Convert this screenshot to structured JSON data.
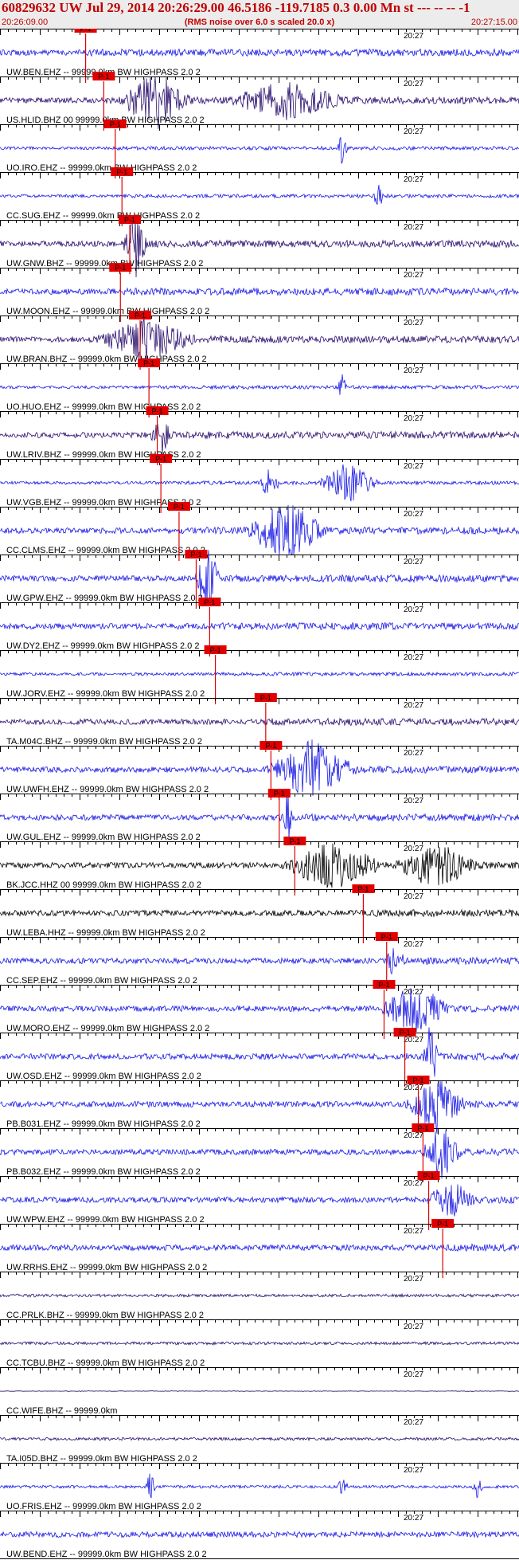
{
  "header": {
    "title": "60829632 UW Jul 29, 2014 20:26:29.00   46.5186 -119.7185  0.3 0.00 Mn st --- -- --  -1",
    "start_time": "20:26:09.00",
    "subtitle": "(RMS noise over 6.0 s scaled 20.0 x)",
    "end_time": "20:27:15.00"
  },
  "time_label": "20:27",
  "pick_label": "P-1",
  "colors": {
    "header_text": "#c00000",
    "pick": "#e00000"
  },
  "traces": [
    {
      "label": "UW.BEN.EHZ -- 99999.0km BW  HIGHPASS  2.0  2",
      "pick": 0.165,
      "color": "#1a1ae6",
      "bursts": []
    },
    {
      "label": "US.HLID.BHZ 00 99999.0km BW  HIGHPASS  2.0  2",
      "pick": 0.2,
      "color": "#2a0f6e",
      "bursts": [
        [
          0.3,
          0.07,
          2.5
        ],
        [
          0.55,
          0.12,
          1.5
        ]
      ]
    },
    {
      "label": "UO.IRO.EHZ -- 99999.0km BW  HIGHPASS  2.0  2",
      "pick": 0.222,
      "color": "#1a1ae6",
      "bursts": [
        [
          0.66,
          0.01,
          3
        ]
      ],
      "quiet": true
    },
    {
      "label": "CC.SUG.EHZ -- 99999.0km BW  HIGHPASS  2.0  2",
      "pick": 0.235,
      "color": "#1a1ae6",
      "bursts": [
        [
          0.73,
          0.01,
          3
        ]
      ],
      "quiet": true
    },
    {
      "label": "UW.GNW.BHZ -- 99999.0km BW  HIGHPASS  2.0  2",
      "pick": 0.25,
      "color": "#2a0f6e",
      "bursts": [
        [
          0.26,
          0.025,
          3
        ]
      ]
    },
    {
      "label": "UW.MOON.EHZ -- 99999.0km BW  HIGHPASS  2.0  2",
      "pick": 0.232,
      "color": "#1a1ae6",
      "bursts": []
    },
    {
      "label": "UW.BRAN.BHZ -- 99999.0km BW  HIGHPASS  2.0  2",
      "pick": 0.27,
      "color": "#2a0f6e",
      "bursts": [
        [
          0.28,
          0.1,
          1.8
        ]
      ]
    },
    {
      "label": "UO.HUO.EHZ -- 99999.0km BW  HIGHPASS  2.0  2",
      "pick": 0.287,
      "color": "#1a1ae6",
      "bursts": [
        [
          0.66,
          0.01,
          3
        ]
      ],
      "quiet": true
    },
    {
      "label": "UW.LRIV.BHZ -- 99999.0km BW  HIGHPASS  2.0  2",
      "pick": 0.303,
      "color": "#2a0f6e",
      "bursts": [
        [
          0.31,
          0.02,
          1.8
        ]
      ]
    },
    {
      "label": "UW.VGB.EHZ -- 99999.0km BW  HIGHPASS  2.0  2",
      "pick": 0.31,
      "color": "#1a1ae6",
      "bursts": [
        [
          0.52,
          0.02,
          3
        ],
        [
          0.67,
          0.06,
          3.5
        ]
      ],
      "quiet": true
    },
    {
      "label": "CC.CLMS.EHZ -- 99999.0km BW  HIGHPASS  2.0  2",
      "pick": 0.345,
      "color": "#1a1ae6",
      "bursts": [
        [
          0.55,
          0.08,
          2.5
        ]
      ]
    },
    {
      "label": "UW.GPW.EHZ -- 99999.0km BW  HIGHPASS  2.0  2",
      "pick": 0.378,
      "color": "#1a1ae6",
      "bursts": [
        [
          0.4,
          0.025,
          3
        ]
      ]
    },
    {
      "label": "UW.DY2.EHZ -- 99999.0km BW  HIGHPASS  2.0  2",
      "pick": 0.404,
      "color": "#1a1ae6",
      "bursts": []
    },
    {
      "label": "UW.JORV.EHZ -- 99999.0km BW  HIGHPASS  2.0  2",
      "pick": 0.415,
      "color": "#1a1ae6",
      "bursts": [],
      "quiet": true
    },
    {
      "label": "TA.M04C.BHZ -- 99999.0km BW  HIGHPASS  2.0  2",
      "pick": 0.512,
      "color": "#2a0f6e",
      "bursts": []
    },
    {
      "label": "UW.UWFH.EHZ -- 99999.0km BW  HIGHPASS  2.0  2",
      "pick": 0.522,
      "color": "#1a1ae6",
      "bursts": [
        [
          0.6,
          0.09,
          2.5
        ]
      ]
    },
    {
      "label": "UW.GUL.EHZ -- 99999.0km BW  HIGHPASS  2.0  2",
      "pick": 0.538,
      "color": "#1a1ae6",
      "bursts": [
        [
          0.555,
          0.008,
          3
        ]
      ]
    },
    {
      "label": "BK.JCC.HHZ 00 99999.0km BW  HIGHPASS  2.0  2",
      "pick": 0.568,
      "color": "#000000",
      "bursts": [
        [
          0.64,
          0.1,
          2
        ],
        [
          0.84,
          0.08,
          2
        ]
      ]
    },
    {
      "label": "UW.LEBA.HHZ -- 99999.0km BW  HIGHPASS  2.0  2",
      "pick": 0.7,
      "color": "#000000",
      "bursts": []
    },
    {
      "label": "CC.SEP.EHZ -- 99999.0km BW  HIGHPASS  2.0  2",
      "pick": 0.745,
      "color": "#1a1ae6",
      "bursts": [
        [
          0.76,
          0.02,
          1.5
        ]
      ]
    },
    {
      "label": "UW.MORO.EHZ -- 99999.0km BW  HIGHPASS  2.0  2",
      "pick": 0.74,
      "color": "#1a1ae6",
      "bursts": [
        [
          0.8,
          0.07,
          2
        ]
      ]
    },
    {
      "label": "UW.OSD.EHZ -- 99999.0km BW  HIGHPASS  2.0  2",
      "pick": 0.78,
      "color": "#1a1ae6",
      "bursts": [
        [
          0.83,
          0.015,
          3
        ]
      ]
    },
    {
      "label": "PB.B031.EHZ -- 99999.0km BW  HIGHPASS  2.0  2",
      "pick": 0.806,
      "color": "#1a1ae6",
      "bursts": [
        [
          0.84,
          0.06,
          2.5
        ]
      ]
    },
    {
      "label": "PB.B032.EHZ -- 99999.0km BW  HIGHPASS  2.0  2",
      "pick": 0.815,
      "color": "#1a1ae6",
      "bursts": [
        [
          0.85,
          0.04,
          2.2
        ]
      ]
    },
    {
      "label": "UW.WPW.EHZ -- 99999.0km BW  HIGHPASS  2.0  2",
      "pick": 0.826,
      "color": "#1a1ae6",
      "bursts": [
        [
          0.87,
          0.05,
          1.5
        ]
      ]
    },
    {
      "label": "UW.RRHS.EHZ -- 99999.0km BW  HIGHPASS  2.0  2",
      "pick": 0.853,
      "color": "#1a1ae6",
      "bursts": []
    },
    {
      "label": "CC.PRLK.BHZ -- 99999.0km BW  HIGHPASS  2.0  2",
      "pick": null,
      "color": "#2a0f6e",
      "bursts": [],
      "quiet": true
    },
    {
      "label": "CC.TCBU.BHZ -- 99999.0km BW  HIGHPASS  2.0  2",
      "pick": null,
      "color": "#2a0f6e",
      "bursts": [],
      "quiet": true
    },
    {
      "label": "CC.WIFE.BHZ -- 99999.0km",
      "pick": null,
      "color": "#2a0f6e",
      "bursts": [],
      "flat": true
    },
    {
      "label": "TA.I05D.BHZ -- 99999.0km BW  HIGHPASS  2.0  2",
      "pick": null,
      "color": "#2a0f6e",
      "bursts": [],
      "quiet": true
    },
    {
      "label": "UO.FRIS.EHZ -- 99999.0km BW  HIGHPASS  2.0  2",
      "pick": null,
      "color": "#1a1ae6",
      "bursts": [
        [
          0.29,
          0.01,
          3
        ],
        [
          0.66,
          0.01,
          3
        ],
        [
          0.92,
          0.01,
          2
        ]
      ],
      "quiet": true
    },
    {
      "label": "UW.BEND.EHZ -- 99999.0km BW  HIGHPASS  2.0  2",
      "pick": null,
      "color": "#1a1ae6",
      "bursts": []
    }
  ]
}
